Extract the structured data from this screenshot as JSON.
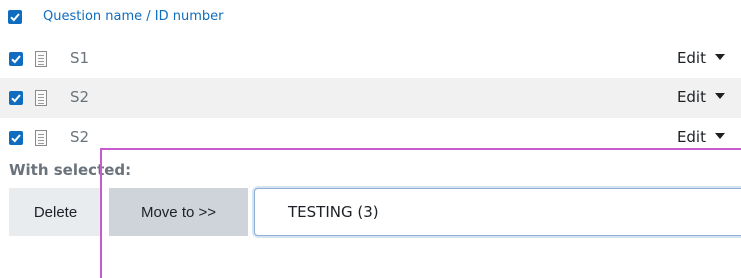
{
  "header": {
    "column_label": "Question name / ID number",
    "select_all_checked": true
  },
  "questions": [
    {
      "name": "S1",
      "checked": true,
      "action": "Edit"
    },
    {
      "name": "S2",
      "checked": true,
      "action": "Edit"
    },
    {
      "name": "S2",
      "checked": true,
      "action": "Edit"
    }
  ],
  "bulk": {
    "label": "With selected:",
    "delete_label": "Delete",
    "move_label": "Move to >>",
    "category_value": "TESTING (3)"
  },
  "colors": {
    "accent": "#0f6cbf",
    "highlight_overlay": "#c85bd0"
  }
}
